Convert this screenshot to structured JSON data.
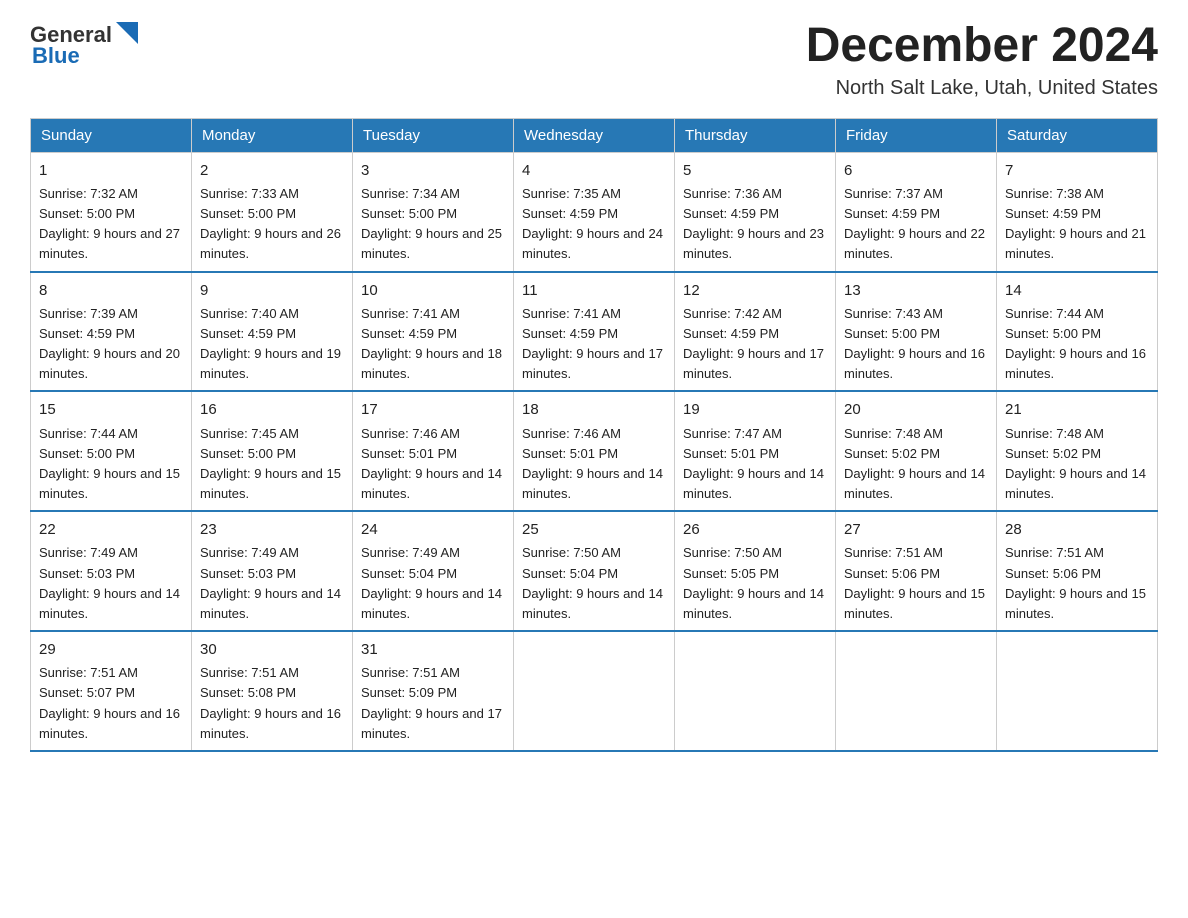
{
  "header": {
    "logo_general": "General",
    "logo_blue": "Blue",
    "month_title": "December 2024",
    "location": "North Salt Lake, Utah, United States"
  },
  "days_of_week": [
    "Sunday",
    "Monday",
    "Tuesday",
    "Wednesday",
    "Thursday",
    "Friday",
    "Saturday"
  ],
  "weeks": [
    [
      {
        "day": "1",
        "sunrise": "7:32 AM",
        "sunset": "5:00 PM",
        "daylight": "9 hours and 27 minutes."
      },
      {
        "day": "2",
        "sunrise": "7:33 AM",
        "sunset": "5:00 PM",
        "daylight": "9 hours and 26 minutes."
      },
      {
        "day": "3",
        "sunrise": "7:34 AM",
        "sunset": "5:00 PM",
        "daylight": "9 hours and 25 minutes."
      },
      {
        "day": "4",
        "sunrise": "7:35 AM",
        "sunset": "4:59 PM",
        "daylight": "9 hours and 24 minutes."
      },
      {
        "day": "5",
        "sunrise": "7:36 AM",
        "sunset": "4:59 PM",
        "daylight": "9 hours and 23 minutes."
      },
      {
        "day": "6",
        "sunrise": "7:37 AM",
        "sunset": "4:59 PM",
        "daylight": "9 hours and 22 minutes."
      },
      {
        "day": "7",
        "sunrise": "7:38 AM",
        "sunset": "4:59 PM",
        "daylight": "9 hours and 21 minutes."
      }
    ],
    [
      {
        "day": "8",
        "sunrise": "7:39 AM",
        "sunset": "4:59 PM",
        "daylight": "9 hours and 20 minutes."
      },
      {
        "day": "9",
        "sunrise": "7:40 AM",
        "sunset": "4:59 PM",
        "daylight": "9 hours and 19 minutes."
      },
      {
        "day": "10",
        "sunrise": "7:41 AM",
        "sunset": "4:59 PM",
        "daylight": "9 hours and 18 minutes."
      },
      {
        "day": "11",
        "sunrise": "7:41 AM",
        "sunset": "4:59 PM",
        "daylight": "9 hours and 17 minutes."
      },
      {
        "day": "12",
        "sunrise": "7:42 AM",
        "sunset": "4:59 PM",
        "daylight": "9 hours and 17 minutes."
      },
      {
        "day": "13",
        "sunrise": "7:43 AM",
        "sunset": "5:00 PM",
        "daylight": "9 hours and 16 minutes."
      },
      {
        "day": "14",
        "sunrise": "7:44 AM",
        "sunset": "5:00 PM",
        "daylight": "9 hours and 16 minutes."
      }
    ],
    [
      {
        "day": "15",
        "sunrise": "7:44 AM",
        "sunset": "5:00 PM",
        "daylight": "9 hours and 15 minutes."
      },
      {
        "day": "16",
        "sunrise": "7:45 AM",
        "sunset": "5:00 PM",
        "daylight": "9 hours and 15 minutes."
      },
      {
        "day": "17",
        "sunrise": "7:46 AM",
        "sunset": "5:01 PM",
        "daylight": "9 hours and 14 minutes."
      },
      {
        "day": "18",
        "sunrise": "7:46 AM",
        "sunset": "5:01 PM",
        "daylight": "9 hours and 14 minutes."
      },
      {
        "day": "19",
        "sunrise": "7:47 AM",
        "sunset": "5:01 PM",
        "daylight": "9 hours and 14 minutes."
      },
      {
        "day": "20",
        "sunrise": "7:48 AM",
        "sunset": "5:02 PM",
        "daylight": "9 hours and 14 minutes."
      },
      {
        "day": "21",
        "sunrise": "7:48 AM",
        "sunset": "5:02 PM",
        "daylight": "9 hours and 14 minutes."
      }
    ],
    [
      {
        "day": "22",
        "sunrise": "7:49 AM",
        "sunset": "5:03 PM",
        "daylight": "9 hours and 14 minutes."
      },
      {
        "day": "23",
        "sunrise": "7:49 AM",
        "sunset": "5:03 PM",
        "daylight": "9 hours and 14 minutes."
      },
      {
        "day": "24",
        "sunrise": "7:49 AM",
        "sunset": "5:04 PM",
        "daylight": "9 hours and 14 minutes."
      },
      {
        "day": "25",
        "sunrise": "7:50 AM",
        "sunset": "5:04 PM",
        "daylight": "9 hours and 14 minutes."
      },
      {
        "day": "26",
        "sunrise": "7:50 AM",
        "sunset": "5:05 PM",
        "daylight": "9 hours and 14 minutes."
      },
      {
        "day": "27",
        "sunrise": "7:51 AM",
        "sunset": "5:06 PM",
        "daylight": "9 hours and 15 minutes."
      },
      {
        "day": "28",
        "sunrise": "7:51 AM",
        "sunset": "5:06 PM",
        "daylight": "9 hours and 15 minutes."
      }
    ],
    [
      {
        "day": "29",
        "sunrise": "7:51 AM",
        "sunset": "5:07 PM",
        "daylight": "9 hours and 16 minutes."
      },
      {
        "day": "30",
        "sunrise": "7:51 AM",
        "sunset": "5:08 PM",
        "daylight": "9 hours and 16 minutes."
      },
      {
        "day": "31",
        "sunrise": "7:51 AM",
        "sunset": "5:09 PM",
        "daylight": "9 hours and 17 minutes."
      },
      null,
      null,
      null,
      null
    ]
  ]
}
